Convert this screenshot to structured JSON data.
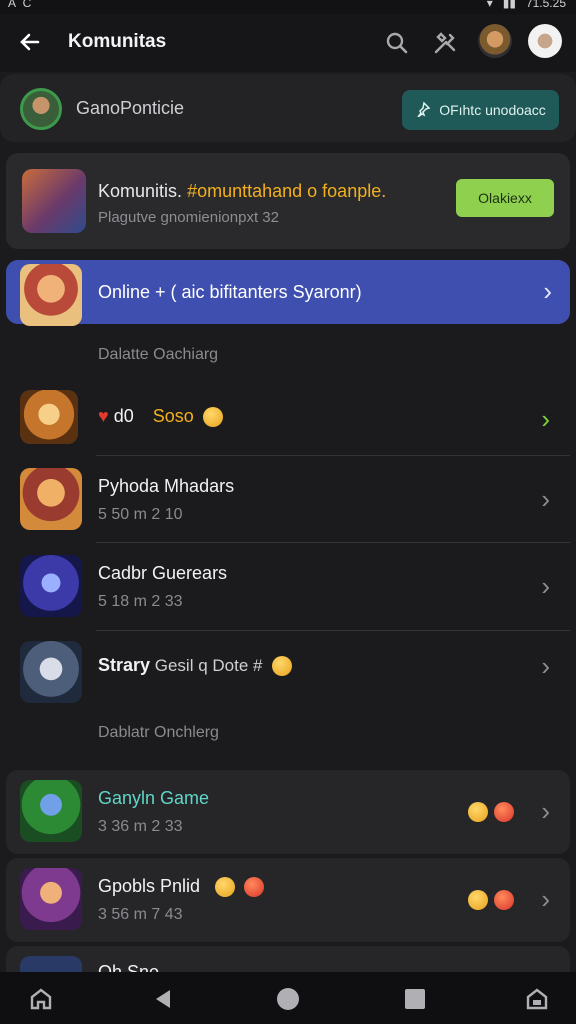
{
  "status": {
    "left": "A C",
    "right_time": "71.5.25"
  },
  "appbar": {
    "title": "Komunitas",
    "icons": [
      "back-arrow-icon",
      "search-icon",
      "tools-icon"
    ]
  },
  "profile": {
    "name": "GanoPonticie",
    "button_label": "OFıhtc unodoacc",
    "button_icon": "pin-icon"
  },
  "featured": {
    "title_main": "Komunitis.",
    "title_highlight": "#omunttahand",
    "title_rest": " o foanple.",
    "subtitle": "Plagutve gnomienionpxt 32",
    "button_label": "Olakiexx"
  },
  "online_bar": {
    "label": "Online  +  ( aic bifitanters Syaronr)"
  },
  "sections": {
    "first": "Dalatte Oachiarg",
    "second": "Dablatr Onchlerg"
  },
  "rows": [
    {
      "title": "d0",
      "extra": "Soso",
      "meta": "",
      "accent": "#f2b01e"
    },
    {
      "title": "Pyhoda Mhadars",
      "meta": "5 50 m 2 10"
    },
    {
      "title": "Cadbr Guerears",
      "meta": "5 18 m 2 33"
    },
    {
      "title": "Strary",
      "title_rest": " Gesil q Dote  #",
      "meta": ""
    },
    {
      "title": "Ganyln Game",
      "meta": "3 36 m 2 33",
      "color": "#5fd7c8"
    },
    {
      "title": "Gpobls Pnlid",
      "meta": "3 56 m 7 43"
    },
    {
      "title": "Oh Sno",
      "meta": ""
    }
  ],
  "colors": {
    "accent_blue": "#3f4fb0",
    "accent_green": "#8fd14f",
    "teal_button": "#1f5958",
    "highlight": "#f2b01e"
  }
}
